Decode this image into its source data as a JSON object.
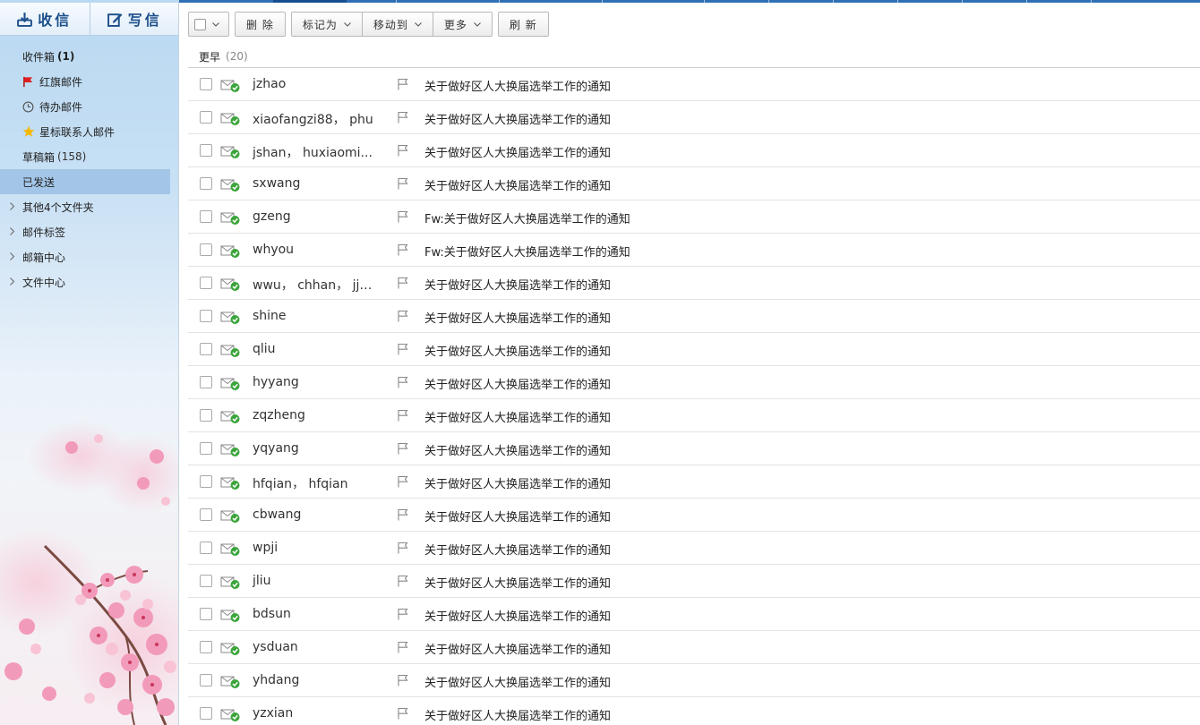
{
  "sidebar": {
    "receive_label": "收信",
    "compose_label": "写信",
    "items": [
      {
        "name": "inbox",
        "label": "收件箱",
        "count": "(1)",
        "icon": "none"
      },
      {
        "name": "flagged",
        "label": "红旗邮件",
        "icon": "red-flag-icon"
      },
      {
        "name": "todo",
        "label": "待办邮件",
        "icon": "clock-icon"
      },
      {
        "name": "starred",
        "label": "星标联系人邮件",
        "icon": "star-icon"
      },
      {
        "name": "drafts",
        "label": "草稿箱",
        "count": "(158)",
        "icon": "none"
      },
      {
        "name": "sent",
        "label": "已发送",
        "icon": "none",
        "selected": true
      }
    ],
    "folders": [
      {
        "name": "other-folders",
        "label": "其他4个文件夹"
      },
      {
        "name": "mail-tags",
        "label": "邮件标签"
      },
      {
        "name": "mailbox-center",
        "label": "邮箱中心"
      },
      {
        "name": "file-center",
        "label": "文件中心"
      }
    ]
  },
  "toolbar": {
    "delete_label": "删 除",
    "mark_as_label": "标记为",
    "move_to_label": "移动到",
    "more_label": "更多",
    "refresh_label": "刷 新"
  },
  "group": {
    "label": "更早",
    "count": "(20)"
  },
  "messages": [
    {
      "sender": "jzhao",
      "subject": "关于做好区人大换届选举工作的通知"
    },
    {
      "sender": "xiaofangzi88， phu",
      "subject": "关于做好区人大换届选举工作的通知"
    },
    {
      "sender": "jshan， huxiaomi...",
      "subject": "关于做好区人大换届选举工作的通知"
    },
    {
      "sender": "sxwang",
      "subject": "关于做好区人大换届选举工作的通知"
    },
    {
      "sender": "gzeng",
      "subject": "Fw:关于做好区人大换届选举工作的通知"
    },
    {
      "sender": "whyou",
      "subject": "Fw:关于做好区人大换届选举工作的通知"
    },
    {
      "sender": "wwu， chhan， jjz...",
      "subject": "关于做好区人大换届选举工作的通知"
    },
    {
      "sender": "shine",
      "subject": "关于做好区人大换届选举工作的通知"
    },
    {
      "sender": "qliu",
      "subject": "关于做好区人大换届选举工作的通知"
    },
    {
      "sender": "hyyang",
      "subject": "关于做好区人大换届选举工作的通知"
    },
    {
      "sender": "zqzheng",
      "subject": "关于做好区人大换届选举工作的通知"
    },
    {
      "sender": "yqyang",
      "subject": "关于做好区人大换届选举工作的通知"
    },
    {
      "sender": "hfqian， hfqian",
      "subject": "关于做好区人大换届选举工作的通知"
    },
    {
      "sender": "cbwang",
      "subject": "关于做好区人大换届选举工作的通知"
    },
    {
      "sender": "wpji",
      "subject": "关于做好区人大换届选举工作的通知"
    },
    {
      "sender": "jliu",
      "subject": "关于做好区人大换届选举工作的通知"
    },
    {
      "sender": "bdsun",
      "subject": "关于做好区人大换届选举工作的通知"
    },
    {
      "sender": "ysduan",
      "subject": "关于做好区人大换届选举工作的通知"
    },
    {
      "sender": "yhdang",
      "subject": "关于做好区人大换届选举工作的通知"
    },
    {
      "sender": "yzxian",
      "subject": "关于做好区人大换届选举工作的通知"
    }
  ],
  "colors": {
    "accent": "#2f6fb5",
    "selected_bg": "#a3c6e8",
    "sent_check": "#3aa53a",
    "flag_red": "#e02020",
    "star_yellow": "#f5b800"
  }
}
